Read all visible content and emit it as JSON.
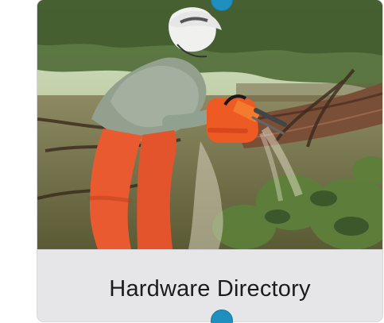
{
  "card": {
    "title": "Hardware Directory"
  },
  "photo": {
    "icon": "photo-of-person-using-chainsaw-on-fallen-tree"
  },
  "colors": {
    "accent_handle": "#1f8fbf",
    "caption_bg": "#e6e6e8",
    "caption_text": "#1c1c1e"
  }
}
